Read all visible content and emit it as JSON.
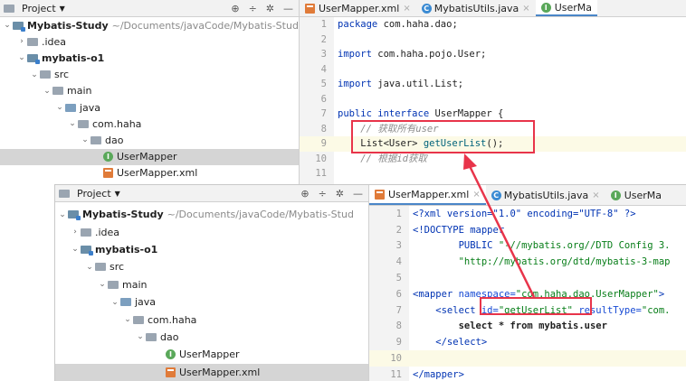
{
  "project_label": "Project",
  "tree": {
    "root_name": "Mybatis-Study",
    "root_path": "~/Documents/javaCode/Mybatis-Stud",
    "idea": ".idea",
    "module": "mybatis-o1",
    "src": "src",
    "main": "main",
    "java": "java",
    "pkg": "com.haha",
    "dao": "dao",
    "mapper": "UserMapper",
    "mapper_xml": "UserMapper.xml"
  },
  "tabs_top": [
    {
      "label": "UserMapper.xml"
    },
    {
      "label": "MybatisUtils.java"
    },
    {
      "label": "UserMa"
    }
  ],
  "tabs_bottom": [
    {
      "label": "UserMapper.xml"
    },
    {
      "label": "MybatisUtils.java"
    },
    {
      "label": "UserMa"
    }
  ],
  "java_code": {
    "l1_kw": "package",
    "l1_rest": " com.haha.dao;",
    "l3_kw": "import",
    "l3_rest": " com.haha.pojo.User;",
    "l5_kw": "import",
    "l5_rest": " java.util.List;",
    "l7_kw": "public interface",
    "l7_rest": " UserMapper {",
    "l8_cm": "    // 获取所有user",
    "l9_pre": "    List<User> ",
    "l9_fn": "getUserList",
    "l9_post": "();",
    "l10_cm": "    // 根据id获取"
  },
  "xml_code": {
    "l1": "<?xml version=\"1.0\" encoding=\"UTF-8\" ?>",
    "l2": "<!DOCTYPE mapper",
    "l3_a": "        PUBLIC ",
    "l3_b": "\"-//mybatis.org//DTD Config 3.",
    "l4": "        \"http://mybatis.org/dtd/mybatis-3-map",
    "l6_a": "<mapper ",
    "l6_b": "namespace=",
    "l6_c": "\"com.haha.dao.UserMapper\"",
    "l6_d": ">",
    "l7_a": "    <select ",
    "l7_b": "id=",
    "l7_c": "\"getUserList\"",
    "l7_d": " resultType=",
    "l7_e": "\"com.",
    "l8": "        select * from mybatis.user",
    "l9": "    </select>",
    "l11": "</mapper>"
  },
  "line_numbers_top": [
    "1",
    "2",
    "3",
    "4",
    "5",
    "6",
    "7",
    "8",
    "9",
    "10",
    "11"
  ],
  "line_numbers_bottom": [
    "1",
    "2",
    "3",
    "4",
    "5",
    "6",
    "7",
    "8",
    "9",
    "10",
    "11"
  ],
  "colors": {
    "annotation": "#e8344a",
    "selection": "#d5d5d5",
    "tab_underline": "#4a86c8"
  }
}
